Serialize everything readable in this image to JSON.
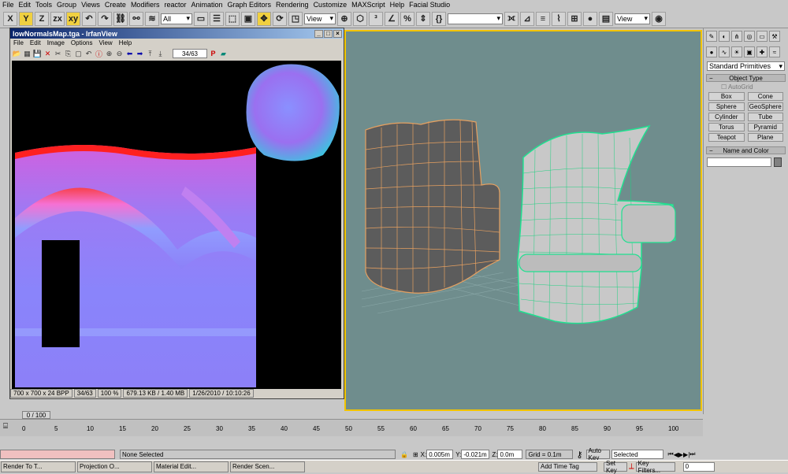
{
  "menu": [
    "File",
    "Edit",
    "Tools",
    "Group",
    "Views",
    "Create",
    "Modifiers",
    "reactor",
    "Animation",
    "Graph Editors",
    "Rendering",
    "Customize",
    "MAXScript",
    "Help",
    "Facial Studio"
  ],
  "toolbar": {
    "all_filter": "All",
    "ref_coord_1": "View",
    "ref_coord_2": "View"
  },
  "irfanview": {
    "title": "lowNormalsMap.tga - IrfanView",
    "menu": [
      "File",
      "Edit",
      "Image",
      "Options",
      "View",
      "Help"
    ],
    "page_counter": "34/63",
    "status": [
      "700 x 700 x 24 BPP",
      "34/63",
      "100 %",
      "679.13 KB / 1.40 MB",
      "1/26/2010 / 10:10:26"
    ]
  },
  "command_panel": {
    "dropdown": "Standard Primitives",
    "object_type_header": "Object Type",
    "autogrid": "AutoGrid",
    "primitives": [
      "Box",
      "Cone",
      "Sphere",
      "GeoSphere",
      "Cylinder",
      "Tube",
      "Torus",
      "Pyramid",
      "Teapot",
      "Plane"
    ],
    "name_color_header": "Name and Color"
  },
  "timeline": {
    "slider": "0 / 100",
    "ticks": [
      "0",
      "5",
      "10",
      "15",
      "20",
      "25",
      "30",
      "35",
      "40",
      "45",
      "50",
      "55",
      "60",
      "65",
      "70",
      "75",
      "80",
      "85",
      "90",
      "95",
      "100"
    ]
  },
  "status": {
    "selection": "None Selected",
    "x_label": "X:",
    "x_value": "0.005m",
    "y_label": "Y:",
    "y_value": "-0.021m",
    "z_label": "Z:",
    "z_value": "0.0m",
    "grid": "Grid = 0.1m",
    "auto_key": "Auto Key",
    "set_key": "Set Key",
    "selected": "Selected",
    "key_filters": "Key Filters...",
    "add_time_tag": "Add Time Tag",
    "frame": "0"
  },
  "taskbar": [
    "Render To T...",
    "Projection O...",
    "Material Edit...",
    "Render Scen..."
  ]
}
